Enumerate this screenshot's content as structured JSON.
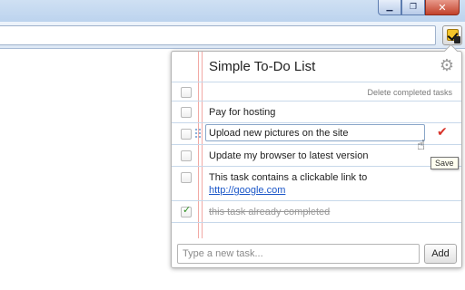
{
  "popup": {
    "title": "Simple To-Do List",
    "settings_icon": "gear-icon",
    "delete_completed_label": "Delete completed tasks",
    "tasks": [
      {
        "text": "Pay for hosting",
        "completed": false
      },
      {
        "text": "Upload new pictures on the site",
        "completed": false,
        "editing": true
      },
      {
        "text": "Update my browser to latest version",
        "completed": false
      },
      {
        "text": "This task contains a clickable link to",
        "link": "http://google.com",
        "completed": false
      },
      {
        "text": "this task already completed",
        "completed": true
      }
    ],
    "save_tooltip": "Save",
    "new_task_placeholder": "Type a new task...",
    "add_label": "Add"
  },
  "colors": {
    "margin_line": "#f2a9a4",
    "rule_line": "#c7d8ea",
    "link": "#1a56c8",
    "save_check": "#d8332a",
    "completed_check": "#2f8f22"
  }
}
